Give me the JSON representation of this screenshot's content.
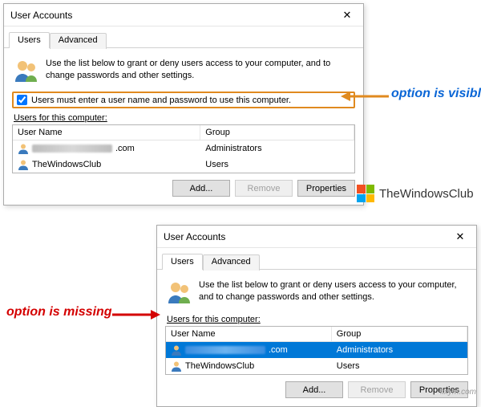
{
  "dialog1": {
    "title": "User Accounts",
    "tabs": {
      "users": "Users",
      "advanced": "Advanced"
    },
    "info": "Use the list below to grant or deny users access to your computer, and to change passwords and other settings.",
    "checkbox_label": "Users must enter a user name and password to use this computer.",
    "section": "Users for this computer:",
    "cols": {
      "name": "User Name",
      "group": "Group"
    },
    "rows": [
      {
        "name_suffix": ".com",
        "group": "Administrators"
      },
      {
        "name": "TheWindowsClub",
        "group": "Users"
      }
    ],
    "buttons": {
      "add": "Add...",
      "remove": "Remove",
      "props": "Properties"
    }
  },
  "dialog2": {
    "title": "User Accounts",
    "tabs": {
      "users": "Users",
      "advanced": "Advanced"
    },
    "info": "Use the list below to grant or deny users access to your computer, and to change passwords and other settings.",
    "section": "Users for this computer:",
    "cols": {
      "name": "User Name",
      "group": "Group"
    },
    "rows": [
      {
        "name_suffix": ".com",
        "group": "Administrators"
      },
      {
        "name": "TheWindowsClub",
        "group": "Users"
      }
    ],
    "buttons": {
      "add": "Add...",
      "remove": "Remove",
      "props": "Properties"
    }
  },
  "annotations": {
    "visible": "option is visible",
    "missing": "option is missing"
  },
  "branding": {
    "logo_text": "TheWindowsClub",
    "watermark": "fixym.com"
  }
}
